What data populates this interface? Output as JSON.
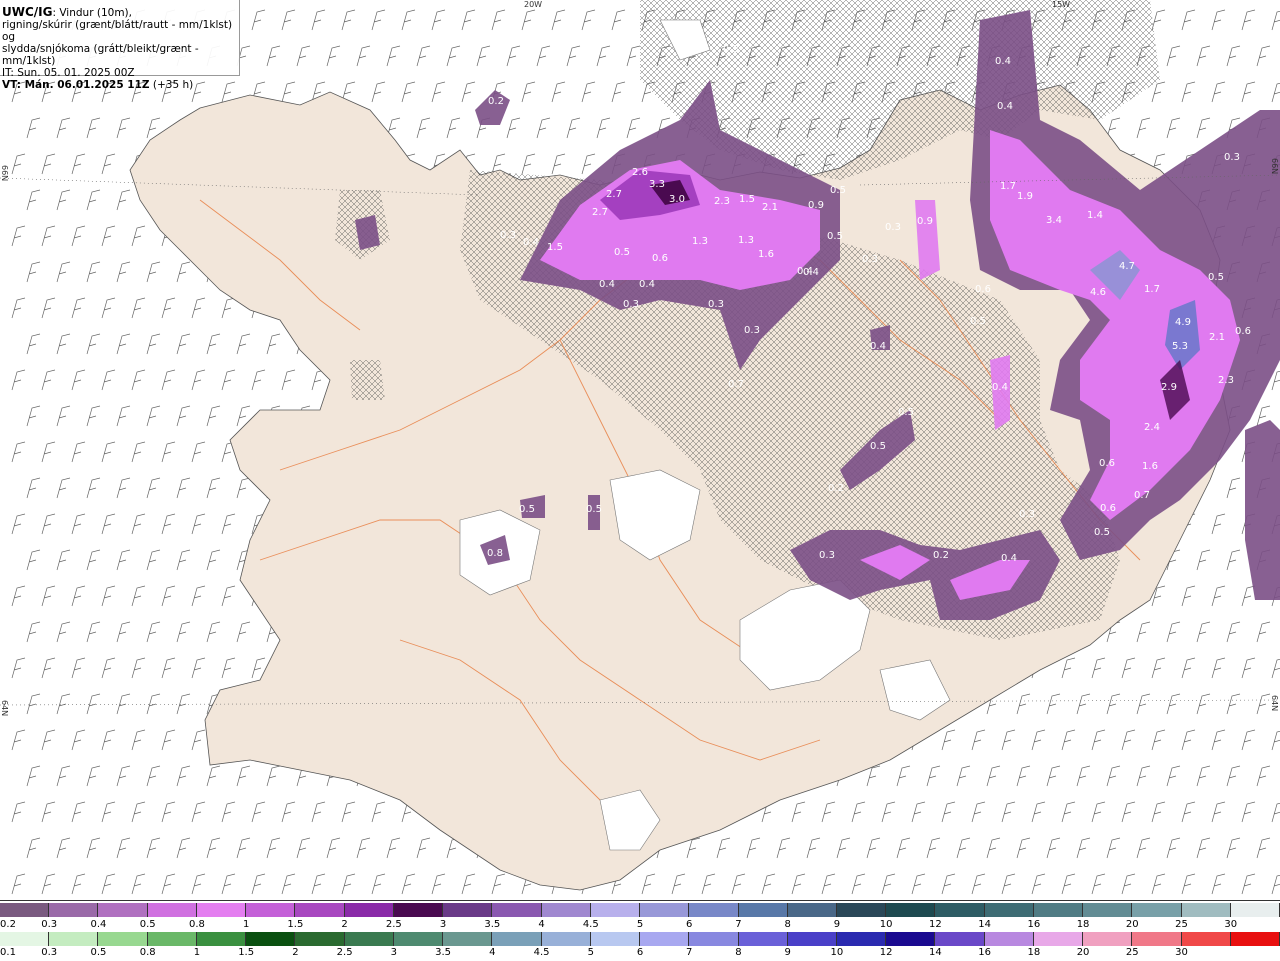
{
  "title": {
    "product": "UWC/IG",
    "line1_rest": ": Vindur (10m),",
    "line2": "rigning/skúrir (grænt/blátt/rautt - mm/1klst) og",
    "line3": "slydda/snjókoma (grátt/bleikt/grænt - mm/1klst)",
    "it": "IT: Sun. 05. 01. 2025 00Z",
    "vt": "VT: Mán. 06.01.2025 11Z",
    "vt_offset": "(+35 h)"
  },
  "grid_labels": {
    "top_20w": "20W",
    "top_15w": "15W",
    "left_66n": "66N",
    "left_64n": "64N",
    "right_64n": "64N",
    "right_66n": "66N"
  },
  "colors": {
    "sea": "#ffffff",
    "land": "#f2e6da",
    "roads": "#e8844a",
    "coast": "#555555"
  },
  "precip_labels": [
    {
      "text": "0.2",
      "kind": "snow"
    },
    {
      "text": "0.3",
      "kind": "snow"
    },
    {
      "text": "2.6",
      "kind": "snow"
    },
    {
      "text": "3.3",
      "kind": "snow"
    },
    {
      "text": "2.7",
      "kind": "snow"
    },
    {
      "text": "2.7",
      "kind": "snow"
    },
    {
      "text": "3.0",
      "kind": "snow"
    },
    {
      "text": "2.3",
      "kind": "snow"
    },
    {
      "text": "1.5",
      "kind": "snow"
    },
    {
      "text": "2.1",
      "kind": "snow"
    },
    {
      "text": "0.9",
      "kind": "snow"
    },
    {
      "text": "0.5",
      "kind": "snow"
    },
    {
      "text": "1.3",
      "kind": "snow"
    },
    {
      "text": "1.3",
      "kind": "snow"
    },
    {
      "text": "0.5",
      "kind": "snow"
    },
    {
      "text": "1.6",
      "kind": "snow"
    },
    {
      "text": "0.6",
      "kind": "snow"
    },
    {
      "text": "0.4",
      "kind": "snow"
    },
    {
      "text": "0.4",
      "kind": "snow"
    },
    {
      "text": "0.4",
      "kind": "snow"
    },
    {
      "text": "0.3",
      "kind": "snow"
    },
    {
      "text": "0.3",
      "kind": "snow"
    },
    {
      "text": "0.3",
      "kind": "snow"
    },
    {
      "text": "0.4",
      "kind": "snow"
    },
    {
      "text": "1.5",
      "kind": "snow"
    },
    {
      "text": "0.3",
      "kind": "snow"
    },
    {
      "text": "0.5",
      "kind": "snow"
    },
    {
      "text": "0.3",
      "kind": "snow"
    },
    {
      "text": "0.9",
      "kind": "snow"
    },
    {
      "text": "0.3",
      "kind": "snow"
    },
    {
      "text": "0.4",
      "kind": "snow"
    },
    {
      "text": "0.4",
      "kind": "snow"
    },
    {
      "text": "1.9",
      "kind": "snow"
    },
    {
      "text": "1.7",
      "kind": "snow"
    },
    {
      "text": "3.4",
      "kind": "snow"
    },
    {
      "text": "1.4",
      "kind": "snow"
    },
    {
      "text": "0.6",
      "kind": "snow"
    },
    {
      "text": "0.5",
      "kind": "snow"
    },
    {
      "text": "0.4",
      "kind": "snow"
    },
    {
      "text": "4.7",
      "kind": "snow"
    },
    {
      "text": "4.6",
      "kind": "snow"
    },
    {
      "text": "1.7",
      "kind": "snow"
    },
    {
      "text": "4.9",
      "kind": "snow"
    },
    {
      "text": "5.3",
      "kind": "snow"
    },
    {
      "text": "2.1",
      "kind": "snow"
    },
    {
      "text": "2.9",
      "kind": "snow"
    },
    {
      "text": "2.3",
      "kind": "snow"
    },
    {
      "text": "2.4",
      "kind": "snow"
    },
    {
      "text": "1.6",
      "kind": "snow"
    },
    {
      "text": "0.6",
      "kind": "snow"
    },
    {
      "text": "0.7",
      "kind": "snow"
    },
    {
      "text": "0.6",
      "kind": "snow"
    },
    {
      "text": "0.5",
      "kind": "snow"
    },
    {
      "text": "0.4",
      "kind": "snow"
    },
    {
      "text": "0.5",
      "kind": "snow"
    },
    {
      "text": "0.5",
      "kind": "snow"
    },
    {
      "text": "0.2",
      "kind": "snow"
    },
    {
      "text": "0.3",
      "kind": "snow"
    },
    {
      "text": "0.2",
      "kind": "snow"
    },
    {
      "text": "0.4",
      "kind": "snow"
    },
    {
      "text": "0.3",
      "kind": "snow"
    },
    {
      "text": "0.7",
      "kind": "snow"
    },
    {
      "text": "0.5",
      "kind": "snow"
    },
    {
      "text": "0.5",
      "kind": "snow"
    },
    {
      "text": "0.8",
      "kind": "snow"
    },
    {
      "text": "0.3",
      "kind": "snow"
    },
    {
      "text": "0.4",
      "kind": "snow"
    },
    {
      "text": "0.5",
      "kind": "snow"
    },
    {
      "text": "0.6",
      "kind": "snow"
    }
  ],
  "legend_snow": {
    "labels": [
      "0.2",
      "0.3",
      "0.4",
      "0.5",
      "0.8",
      "1",
      "1.5",
      "2",
      "2.5",
      "3",
      "3.5",
      "4",
      "4.5",
      "5",
      "6",
      "7",
      "8",
      "9",
      "10",
      "12",
      "14",
      "16",
      "18",
      "20",
      "25",
      "30"
    ],
    "colors": [
      "#7a5a80",
      "#9a6aa8",
      "#b070c0",
      "#d070e0",
      "#e47ef0",
      "#c460d8",
      "#a848c0",
      "#8a2aa8",
      "#4a0a50",
      "#6a3a88",
      "#8a58b0",
      "#a088d0",
      "#b8b0ec",
      "#9898d8",
      "#7888c8",
      "#5878a8",
      "#4a6888",
      "#2a4858",
      "#1e4a50",
      "#2e5c64",
      "#3e6c74",
      "#507c84",
      "#628c94",
      "#78a0a8",
      "#a0bcc0",
      "#e8eeee"
    ]
  },
  "legend_rain": {
    "labels": [
      "0.1",
      "0.3",
      "0.5",
      "0.8",
      "1",
      "1.5",
      "2",
      "2.5",
      "3",
      "3.5",
      "4",
      "4.5",
      "5",
      "6",
      "7",
      "8",
      "9",
      "10",
      "12",
      "14",
      "16",
      "18",
      "20",
      "25",
      "30"
    ],
    "colors": [
      "#e4f6e4",
      "#c4ecc0",
      "#98d890",
      "#6ab868",
      "#3a9040",
      "#0a5010",
      "#2a6a30",
      "#3a7a50",
      "#4e8a70",
      "#6a9890",
      "#7aa0b8",
      "#98b0d8",
      "#b8c8f0",
      "#a8a8f0",
      "#8888e0",
      "#6a60d8",
      "#4a40c8",
      "#2a2ab0",
      "#1a0a90",
      "#6a48c8",
      "#b888e0",
      "#e8a8e8",
      "#f0a0c0",
      "#f07888",
      "#f04848",
      "#e81010"
    ]
  }
}
